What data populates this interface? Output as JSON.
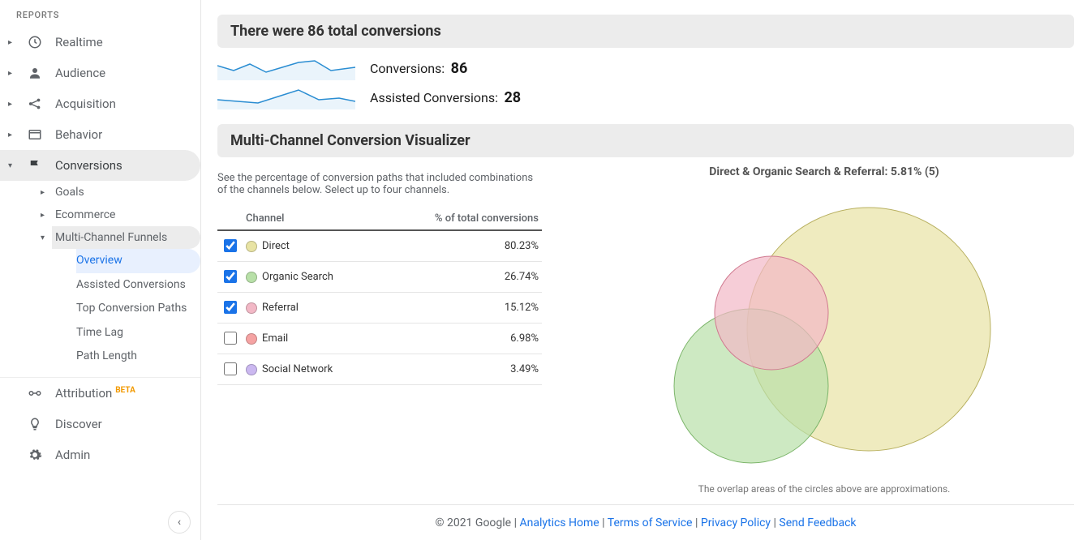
{
  "sidebar": {
    "header": "REPORTS",
    "items": [
      {
        "label": "Realtime"
      },
      {
        "label": "Audience"
      },
      {
        "label": "Acquisition"
      },
      {
        "label": "Behavior"
      },
      {
        "label": "Conversions"
      }
    ],
    "conversions_children": [
      {
        "label": "Goals"
      },
      {
        "label": "Ecommerce"
      },
      {
        "label": "Multi-Channel Funnels"
      }
    ],
    "mcf_children": [
      {
        "label": "Overview"
      },
      {
        "label": "Assisted Conversions"
      },
      {
        "label": "Top Conversion Paths"
      },
      {
        "label": "Time Lag"
      },
      {
        "label": "Path Length"
      }
    ],
    "bottom": [
      {
        "label": "Attribution",
        "beta": "BETA"
      },
      {
        "label": "Discover"
      },
      {
        "label": "Admin"
      }
    ]
  },
  "headline_prefix": "There were ",
  "headline_count": "86",
  "headline_suffix": " total conversions",
  "metrics": {
    "conversions_label": "Conversions:",
    "conversions_value": "86",
    "assisted_label": "Assisted Conversions:",
    "assisted_value": "28"
  },
  "mcv": {
    "title": "Multi-Channel Conversion Visualizer",
    "subtext": "See the percentage of conversion paths that included combinations of the channels below. Select up to four channels.",
    "th_channel": "Channel",
    "th_pct": "% of total conversions",
    "rows": [
      {
        "checked": true,
        "color": "#e8e3a4",
        "name": "Direct",
        "pct": "80.23%"
      },
      {
        "checked": true,
        "color": "#b8e0a8",
        "name": "Organic Search",
        "pct": "26.74%"
      },
      {
        "checked": true,
        "color": "#f2b8c6",
        "name": "Referral",
        "pct": "15.12%"
      },
      {
        "checked": false,
        "color": "#f5a3a3",
        "name": "Email",
        "pct": "6.98%"
      },
      {
        "checked": false,
        "color": "#cbb8f0",
        "name": "Social Network",
        "pct": "3.49%"
      }
    ],
    "venn_title": "Direct & Organic Search & Referral: 5.81% (5)",
    "venn_note": "The overlap areas of the circles above are approximations."
  },
  "footer": {
    "copyright": "© 2021 Google",
    "links": [
      "Analytics Home",
      "Terms of Service",
      "Privacy Policy",
      "Send Feedback"
    ]
  },
  "chart_data": {
    "type": "table",
    "title": "Multi-Channel Conversion % of total conversions",
    "categories": [
      "Direct",
      "Organic Search",
      "Referral",
      "Email",
      "Social Network"
    ],
    "values": [
      80.23,
      26.74,
      15.12,
      6.98,
      3.49
    ],
    "overlap": {
      "combo": "Direct & Organic Search & Referral",
      "percent": 5.81,
      "count": 5
    },
    "totals": {
      "conversions": 86,
      "assisted_conversions": 28
    }
  }
}
